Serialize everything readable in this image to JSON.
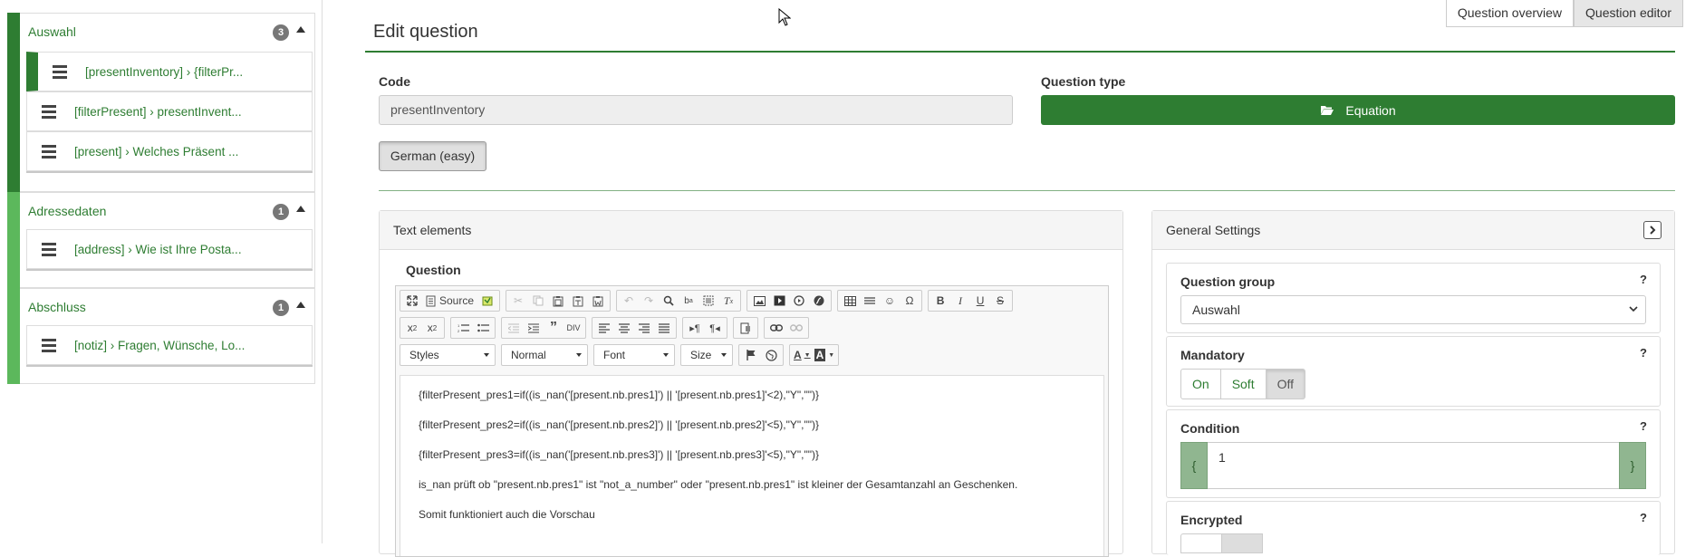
{
  "sidebar": {
    "groups": [
      {
        "title": "Auswahl",
        "count": "3",
        "items": [
          "[presentInventory] › {filterPr...",
          "[filterPresent] › presentInvent...",
          "[present] › Welches Präsent ..."
        ]
      },
      {
        "title": "Adressedaten",
        "count": "1",
        "items": [
          "[address] › Wie ist Ihre Posta..."
        ]
      },
      {
        "title": "Abschluss",
        "count": "1",
        "items": [
          "[notiz] › Fragen, Wünsche, Lo..."
        ]
      }
    ]
  },
  "top_tabs": {
    "overview": "Question overview",
    "editor": "Question editor"
  },
  "page": {
    "title": "Edit question",
    "code_label": "Code",
    "code_value": "presentInventory",
    "qtype_label": "Question type",
    "qtype_value": "Equation",
    "language_button": "German (easy)"
  },
  "text_elements": {
    "heading": "Text elements",
    "question_label": "Question",
    "toolbar": {
      "source": "Source",
      "styles": "Styles",
      "format": "Normal",
      "font": "Font",
      "size": "Size"
    },
    "content": [
      "{filterPresent_pres1=if((is_nan('[present.nb.pres1]') || '[present.nb.pres1]'<2),\"Y\",\"\")}",
      "{filterPresent_pres2=if((is_nan('[present.nb.pres2]') || '[present.nb.pres2]'<5),\"Y\",\"\")}",
      "{filterPresent_pres3=if((is_nan('[present.nb.pres3]') || '[present.nb.pres3]'<5),\"Y\",\"\")}",
      "is_nan prüft ob \"present.nb.pres1\" ist \"not_a_number\" oder \"present.nb.pres1\" ist kleiner der Gesamtanzahl an Geschenken.",
      "Somit funktioniert auch die Vorschau"
    ]
  },
  "general_settings": {
    "heading": "General Settings",
    "question_group": {
      "label": "Question group",
      "help": "?",
      "value": "Auswahl"
    },
    "mandatory": {
      "label": "Mandatory",
      "help": "?",
      "options": [
        "On",
        "Soft",
        "Off"
      ],
      "selected": "Off"
    },
    "condition": {
      "label": "Condition",
      "help": "?",
      "open": "{",
      "value": "1",
      "close": "}"
    },
    "encrypted": {
      "label": "Encrypted",
      "help": "?"
    }
  },
  "colors": {
    "primary": "#2e7d32",
    "light_green": "#5cb85c",
    "condition_addon": "#90b690"
  }
}
